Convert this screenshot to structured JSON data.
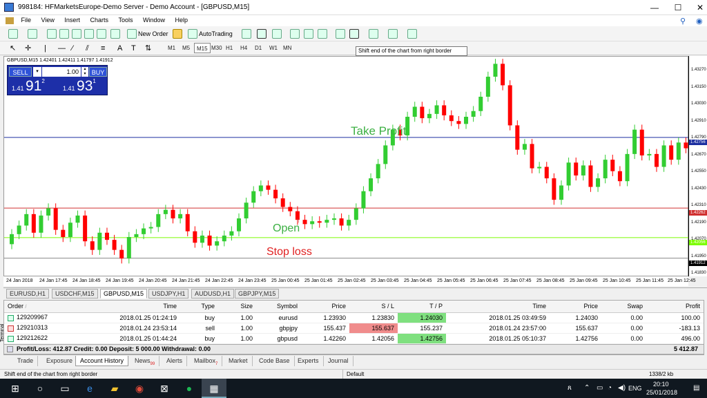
{
  "window": {
    "title": "998184: HFMarketsEurope-Demo Server - Demo Account - [GBPUSD,M15]",
    "minimize": "—",
    "maximize": "☐",
    "close": "✕"
  },
  "menu": [
    "File",
    "View",
    "Insert",
    "Charts",
    "Tools",
    "Window",
    "Help"
  ],
  "toolbar": {
    "new_order": "New Order",
    "autotrading": "AutoTrading"
  },
  "timeframes": [
    "M1",
    "M5",
    "M15",
    "M30",
    "H1",
    "H4",
    "D1",
    "W1",
    "MN"
  ],
  "tooltip": "Shift end of the chart from right border",
  "chart": {
    "header": "GBPUSD,M15  1.42401 1.42411 1.41797 1.41912",
    "annotations": {
      "take_profit": "Take Profit",
      "open": "Open",
      "stop_loss": "Stop loss"
    },
    "price_labels": [
      "1.43270",
      "1.43150",
      "1.43030",
      "1.42910",
      "1.42790",
      "1.42670",
      "1.42550",
      "1.42430",
      "1.42310",
      "1.42190",
      "1.42070",
      "1.41950",
      "1.41830"
    ],
    "tp_marker": "1.42756",
    "sl_marker": "1.42262",
    "bid_marker": "1.41912",
    "ask_marker": "1.42056",
    "time_labels": [
      "24 Jan 2018",
      "24 Jan 17:45",
      "24 Jan 18:45",
      "24 Jan 19:45",
      "24 Jan 20:45",
      "24 Jan 21:45",
      "24 Jan 22:45",
      "24 Jan 23:45",
      "25 Jan 00:45",
      "25 Jan 01:45",
      "25 Jan 02:45",
      "25 Jan 03:45",
      "25 Jan 04:45",
      "25 Jan 05:45",
      "25 Jan 06:45",
      "25 Jan 07:45",
      "25 Jan 08:45",
      "25 Jan 09:45",
      "25 Jan 10:45",
      "25 Jan 11:45",
      "25 Jan 12:45"
    ],
    "colors": {
      "bull": "#32cd32",
      "bear": "#ff0000",
      "tp_line": "#1c2fa0",
      "sl_line": "#d03030",
      "ask_line": "#7cfc00"
    }
  },
  "one_click": {
    "sell": "SELL",
    "buy": "BUY",
    "volume": "1.00",
    "sell_price": {
      "prefix": "1.41",
      "big": "91",
      "sup": "2"
    },
    "buy_price": {
      "prefix": "1.41",
      "big": "93",
      "sup": "1"
    }
  },
  "chart_tabs": [
    "EURUSD,H1",
    "USDCHF,M15",
    "GBPUSD,M15",
    "USDJPY,H1",
    "AUDUSD,H1",
    "GBPJPY,M15"
  ],
  "trade": {
    "headers": [
      "Order",
      "Time",
      "Type",
      "Size",
      "Symbol",
      "Price",
      "S / L",
      "T / P",
      "Time",
      "Price",
      "Swap",
      "Profit"
    ],
    "rows": [
      {
        "order": "129209967",
        "time": "2018.01.25 01:24:19",
        "type": "buy",
        "size": "1.00",
        "symbol": "eurusd",
        "price": "1.23930",
        "sl": "1.23830",
        "tp": "1.24030",
        "ctime": "2018.01.25 03:49:59",
        "cprice": "1.24030",
        "swap": "0.00",
        "profit": "100.00"
      },
      {
        "order": "129210313",
        "time": "2018.01.24 23:53:14",
        "type": "sell",
        "size": "1.00",
        "symbol": "gbpjpy",
        "price": "155.437",
        "sl": "155.637",
        "tp": "155.237",
        "ctime": "2018.01.24 23:57:00",
        "cprice": "155.637",
        "swap": "0.00",
        "profit": "-183.13"
      },
      {
        "order": "129212622",
        "time": "2018.01.25 01:44:24",
        "type": "buy",
        "size": "1.00",
        "symbol": "gbpusd",
        "price": "1.42260",
        "sl": "1.42056",
        "tp": "1.42756",
        "ctime": "2018.01.25 05:10:37",
        "cprice": "1.42756",
        "swap": "0.00",
        "profit": "496.00"
      }
    ],
    "summary": "Profit/Loss: 412.87  Credit: 0.00  Deposit: 5 000.00  Withdrawal: 0.00",
    "total": "5 412.87"
  },
  "terminal_label": "Terminal",
  "terminal_tabs": [
    "Trade",
    "Exposure",
    "Account History",
    "News",
    "Alerts",
    "Mailbox",
    "Market",
    "Code Base",
    "Experts",
    "Journal"
  ],
  "news_count": "99",
  "mailbox_count": "7",
  "statusbar": {
    "hint": "Shift end of the chart from right border",
    "profile": "Default",
    "traffic": "1338/2 kb"
  },
  "taskbar": {
    "time": "20:10",
    "date": "25/01/2018",
    "lang": "ENG"
  }
}
